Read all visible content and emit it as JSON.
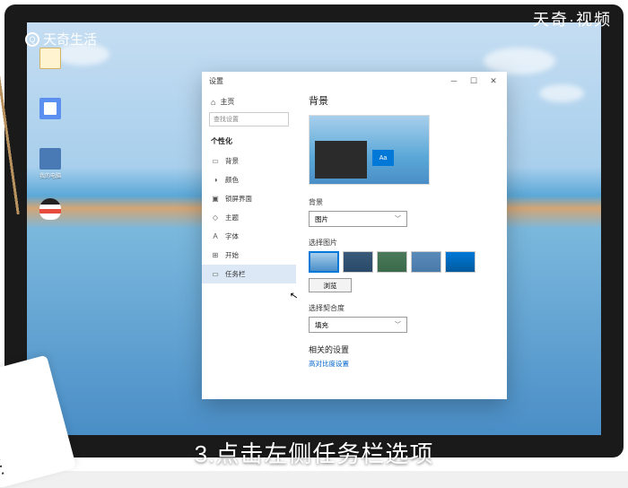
{
  "watermarks": {
    "topright_a": "天奇",
    "topright_b": "视频",
    "topleft": "天奇生活"
  },
  "caption": "3.点击左侧任务栏选项",
  "desktop": {
    "icons": [
      {
        "label": ""
      },
      {
        "label": ""
      },
      {
        "label": "我的电脑"
      },
      {
        "label": ""
      }
    ]
  },
  "settings": {
    "title": "设置",
    "home": "主页",
    "search_placeholder": "查找设置",
    "category": "个性化",
    "nav": [
      {
        "icon": "▭",
        "label": "背景"
      },
      {
        "icon": "◑",
        "label": "颜色"
      },
      {
        "icon": "▣",
        "label": "锁屏界面"
      },
      {
        "icon": "◇",
        "label": "主题"
      },
      {
        "icon": "A",
        "label": "字体"
      },
      {
        "icon": "⊞",
        "label": "开始"
      },
      {
        "icon": "▭",
        "label": "任务栏"
      }
    ],
    "page": {
      "heading": "背景",
      "bg_label": "背景",
      "bg_value": "图片",
      "choose_label": "选择图片",
      "browse": "浏览",
      "fit_label": "选择契合度",
      "fit_value": "填充",
      "related_heading": "相关的设置",
      "related_link": "高对比度设置"
    }
  }
}
